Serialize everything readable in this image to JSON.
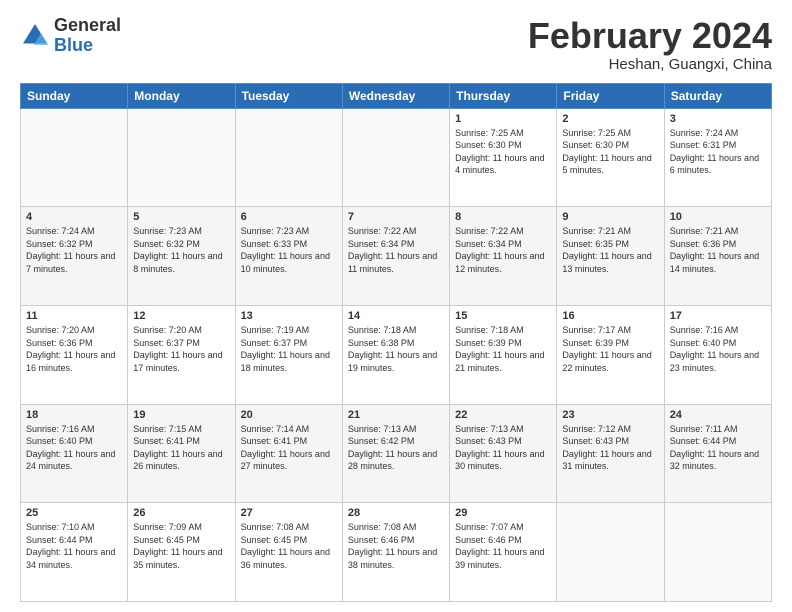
{
  "header": {
    "logo_general": "General",
    "logo_blue": "Blue",
    "month_title": "February 2024",
    "subtitle": "Heshan, Guangxi, China"
  },
  "days_of_week": [
    "Sunday",
    "Monday",
    "Tuesday",
    "Wednesday",
    "Thursday",
    "Friday",
    "Saturday"
  ],
  "weeks": [
    [
      {
        "day": "",
        "info": ""
      },
      {
        "day": "",
        "info": ""
      },
      {
        "day": "",
        "info": ""
      },
      {
        "day": "",
        "info": ""
      },
      {
        "day": "1",
        "info": "Sunrise: 7:25 AM\nSunset: 6:30 PM\nDaylight: 11 hours and 4 minutes."
      },
      {
        "day": "2",
        "info": "Sunrise: 7:25 AM\nSunset: 6:30 PM\nDaylight: 11 hours and 5 minutes."
      },
      {
        "day": "3",
        "info": "Sunrise: 7:24 AM\nSunset: 6:31 PM\nDaylight: 11 hours and 6 minutes."
      }
    ],
    [
      {
        "day": "4",
        "info": "Sunrise: 7:24 AM\nSunset: 6:32 PM\nDaylight: 11 hours and 7 minutes."
      },
      {
        "day": "5",
        "info": "Sunrise: 7:23 AM\nSunset: 6:32 PM\nDaylight: 11 hours and 8 minutes."
      },
      {
        "day": "6",
        "info": "Sunrise: 7:23 AM\nSunset: 6:33 PM\nDaylight: 11 hours and 10 minutes."
      },
      {
        "day": "7",
        "info": "Sunrise: 7:22 AM\nSunset: 6:34 PM\nDaylight: 11 hours and 11 minutes."
      },
      {
        "day": "8",
        "info": "Sunrise: 7:22 AM\nSunset: 6:34 PM\nDaylight: 11 hours and 12 minutes."
      },
      {
        "day": "9",
        "info": "Sunrise: 7:21 AM\nSunset: 6:35 PM\nDaylight: 11 hours and 13 minutes."
      },
      {
        "day": "10",
        "info": "Sunrise: 7:21 AM\nSunset: 6:36 PM\nDaylight: 11 hours and 14 minutes."
      }
    ],
    [
      {
        "day": "11",
        "info": "Sunrise: 7:20 AM\nSunset: 6:36 PM\nDaylight: 11 hours and 16 minutes."
      },
      {
        "day": "12",
        "info": "Sunrise: 7:20 AM\nSunset: 6:37 PM\nDaylight: 11 hours and 17 minutes."
      },
      {
        "day": "13",
        "info": "Sunrise: 7:19 AM\nSunset: 6:37 PM\nDaylight: 11 hours and 18 minutes."
      },
      {
        "day": "14",
        "info": "Sunrise: 7:18 AM\nSunset: 6:38 PM\nDaylight: 11 hours and 19 minutes."
      },
      {
        "day": "15",
        "info": "Sunrise: 7:18 AM\nSunset: 6:39 PM\nDaylight: 11 hours and 21 minutes."
      },
      {
        "day": "16",
        "info": "Sunrise: 7:17 AM\nSunset: 6:39 PM\nDaylight: 11 hours and 22 minutes."
      },
      {
        "day": "17",
        "info": "Sunrise: 7:16 AM\nSunset: 6:40 PM\nDaylight: 11 hours and 23 minutes."
      }
    ],
    [
      {
        "day": "18",
        "info": "Sunrise: 7:16 AM\nSunset: 6:40 PM\nDaylight: 11 hours and 24 minutes."
      },
      {
        "day": "19",
        "info": "Sunrise: 7:15 AM\nSunset: 6:41 PM\nDaylight: 11 hours and 26 minutes."
      },
      {
        "day": "20",
        "info": "Sunrise: 7:14 AM\nSunset: 6:41 PM\nDaylight: 11 hours and 27 minutes."
      },
      {
        "day": "21",
        "info": "Sunrise: 7:13 AM\nSunset: 6:42 PM\nDaylight: 11 hours and 28 minutes."
      },
      {
        "day": "22",
        "info": "Sunrise: 7:13 AM\nSunset: 6:43 PM\nDaylight: 11 hours and 30 minutes."
      },
      {
        "day": "23",
        "info": "Sunrise: 7:12 AM\nSunset: 6:43 PM\nDaylight: 11 hours and 31 minutes."
      },
      {
        "day": "24",
        "info": "Sunrise: 7:11 AM\nSunset: 6:44 PM\nDaylight: 11 hours and 32 minutes."
      }
    ],
    [
      {
        "day": "25",
        "info": "Sunrise: 7:10 AM\nSunset: 6:44 PM\nDaylight: 11 hours and 34 minutes."
      },
      {
        "day": "26",
        "info": "Sunrise: 7:09 AM\nSunset: 6:45 PM\nDaylight: 11 hours and 35 minutes."
      },
      {
        "day": "27",
        "info": "Sunrise: 7:08 AM\nSunset: 6:45 PM\nDaylight: 11 hours and 36 minutes."
      },
      {
        "day": "28",
        "info": "Sunrise: 7:08 AM\nSunset: 6:46 PM\nDaylight: 11 hours and 38 minutes."
      },
      {
        "day": "29",
        "info": "Sunrise: 7:07 AM\nSunset: 6:46 PM\nDaylight: 11 hours and 39 minutes."
      },
      {
        "day": "",
        "info": ""
      },
      {
        "day": "",
        "info": ""
      }
    ]
  ]
}
